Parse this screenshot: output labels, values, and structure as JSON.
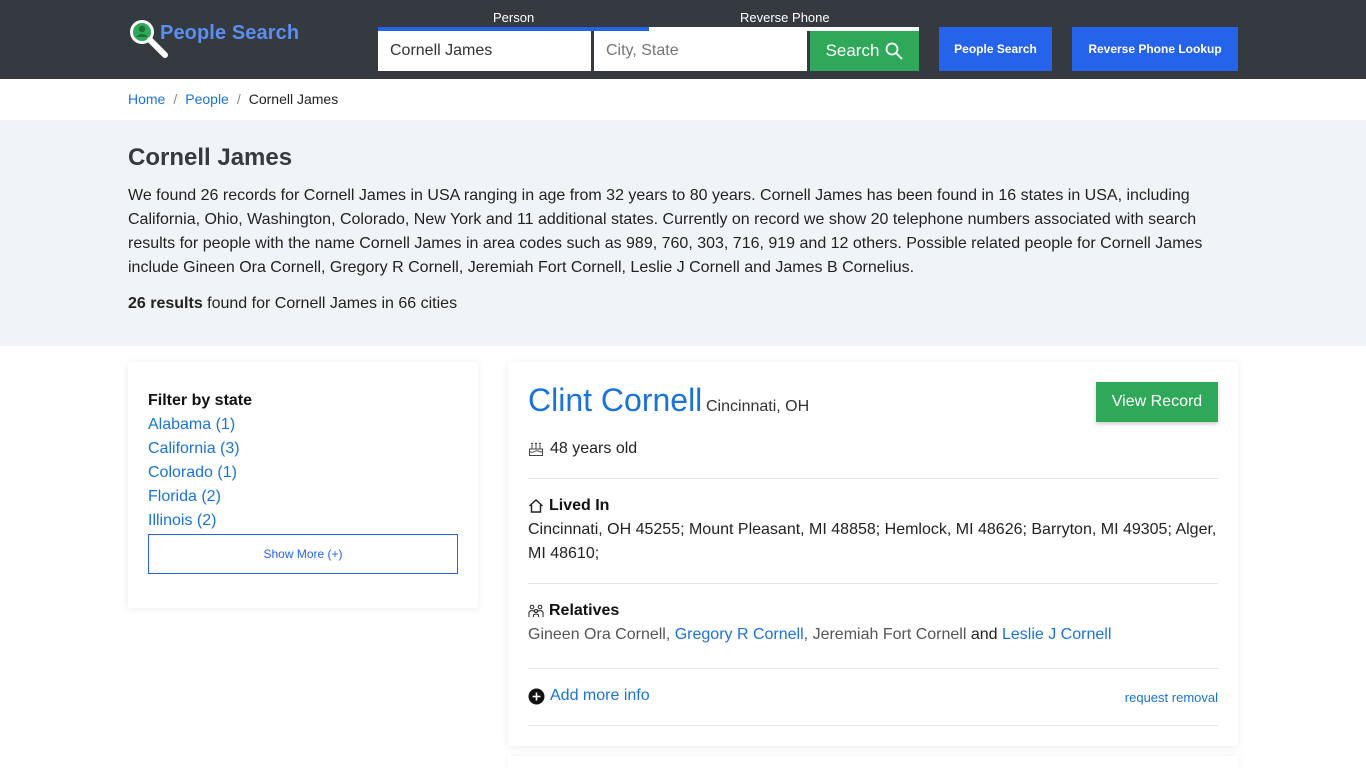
{
  "header": {
    "logo_text": "People Search",
    "tab_person": "Person",
    "tab_reverse_phone": "Reverse Phone",
    "name_value": "Cornell James",
    "location_placeholder": "City, State",
    "search_label": "Search",
    "people_search_button": "People Search",
    "reverse_phone_button": "Reverse Phone Lookup",
    "colors": {
      "bar": "#343a40",
      "accent_blue": "#2563eb",
      "accent_green": "#2fa85a"
    }
  },
  "breadcrumb": {
    "home": "Home",
    "separator": "/",
    "people": "People",
    "current": "Cornell James"
  },
  "hero": {
    "title": "Cornell James",
    "description": "We found 26 records for Cornell James in USA ranging in age from 32 years to 80 years. Cornell James has been found in 16 states in USA, including California, Ohio, Washington, Colorado, New York and 11 additional states. Currently on record we show 20 telephone numbers associated with search results for people with the name Cornell James in area codes such as 989, 760, 303, 716, 919 and 12 others. Possible related people for Cornell James include Gineen Ora Cornell, Gregory R Cornell, Jeremiah Fort Cornell, Leslie J Cornell and James B Cornelius.",
    "results_bold": "26 results",
    "results_rest": " found for Cornell James in 66 cities"
  },
  "filter": {
    "title": "Filter by state",
    "states": [
      "Alabama (1)",
      "California (3)",
      "Colorado (1)",
      "Florida (2)",
      "Illinois (2)"
    ],
    "show_more": "Show More (+)"
  },
  "result": {
    "name": "Clint Cornell",
    "city": "Cincinnati, OH",
    "view_record": "View Record",
    "age": "48 years old",
    "lived_in_title": "Lived In",
    "lived_in": "Cincinnati, OH 45255; Mount Pleasant, MI 48858; Hemlock, MI 48626; Barryton, MI 49305; Alger, MI 48610;",
    "relatives_title": "Relatives",
    "relatives": {
      "r1": "Gineen Ora Cornell",
      "comma1": ", ",
      "r2": "Gregory R Cornell",
      "comma2": ", ",
      "r3": "Jeremiah Fort Cornell",
      "and": " and ",
      "r4": "Leslie J Cornell"
    },
    "add_more_info": "Add more info",
    "request_removal": "request removal"
  },
  "icons": {
    "logo": "magnifier-person-icon",
    "search": "search-icon",
    "age": "cake-icon",
    "home": "home-icon",
    "relatives": "family-icon",
    "add": "plus-circle-icon"
  }
}
